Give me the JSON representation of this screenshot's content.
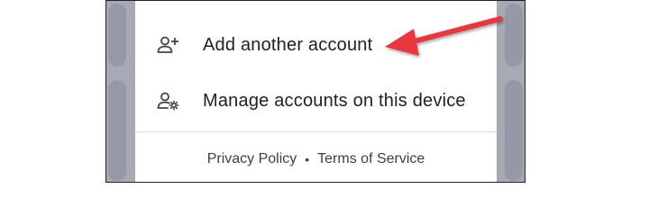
{
  "menu": {
    "items": [
      {
        "label": "Add another account",
        "icon": "person-add-icon"
      },
      {
        "label": "Manage accounts on this device",
        "icon": "manage-accounts-icon"
      }
    ]
  },
  "footer": {
    "privacy_label": "Privacy Policy",
    "separator": "•",
    "terms_label": "Terms of Service"
  },
  "annotation": {
    "arrow_color": "#e8383e",
    "target": "Add another account"
  },
  "colors": {
    "background_dim": "#a6aab5",
    "sheet": "#ffffff",
    "text": "#202124",
    "divider": "#dadce0"
  }
}
